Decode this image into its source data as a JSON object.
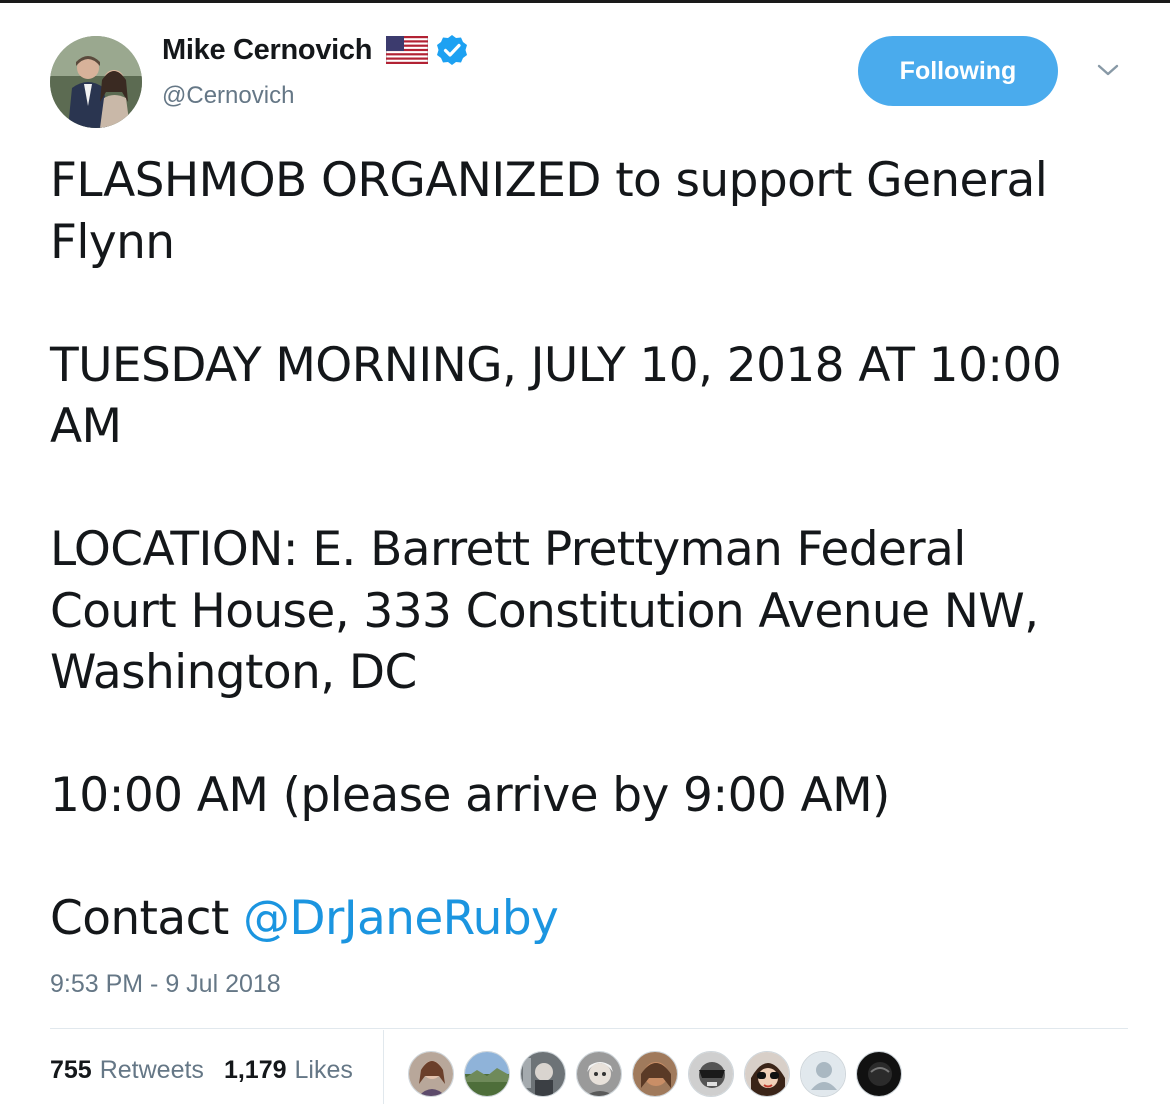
{
  "tweet": {
    "author": {
      "display_name": "Mike Cernovich",
      "handle": "@Cernovich",
      "badges": [
        "us-flag-icon",
        "verified-icon"
      ]
    },
    "follow_button_label": "Following",
    "body": {
      "line1": "FLASHMOB ORGANIZED to support General",
      "line2": "Flynn",
      "line3": "TUESDAY MORNING, JULY 10, 2018 AT 10:00",
      "line4": "AM",
      "line5": "LOCATION:  E. Barrett Prettyman Federal",
      "line6": "Court House, 333 Constitution Avenue NW,",
      "line7": "Washington, DC",
      "line8": "10:00 AM (please arrive by 9:00 AM)",
      "contact_prefix": "Contact ",
      "contact_mention": "@DrJaneRuby"
    },
    "timestamp": "9:53 PM - 9 Jul 2018",
    "stats": {
      "retweets_count": "755",
      "retweets_label": "Retweets",
      "likes_count": "1,179",
      "likes_label": "Likes"
    }
  },
  "colors": {
    "accent": "#1b95e0",
    "follow_button": "#4aabed",
    "muted_text": "#657786",
    "text": "#14171a"
  }
}
